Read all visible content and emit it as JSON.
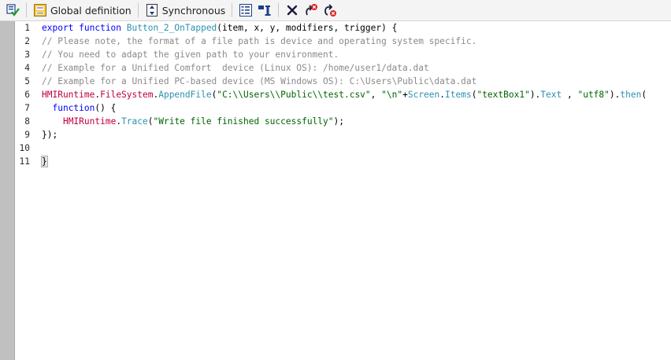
{
  "toolbar": {
    "global_definition_label": "Global definition",
    "synchronous_label": "Synchronous"
  },
  "editor": {
    "line_numbers": [
      "1",
      "2",
      "3",
      "4",
      "5",
      "6",
      "7",
      "8",
      "9",
      "10",
      "11"
    ],
    "lines": [
      {
        "indent": "",
        "tokens": [
          {
            "t": "export function ",
            "c": "kw"
          },
          {
            "t": "Button_2_OnTapped",
            "c": "fn"
          },
          {
            "t": "(item, x, y, modifiers, trigger) {",
            "c": "pl"
          }
        ]
      },
      {
        "indent": "",
        "tokens": [
          {
            "t": "// Please note, the format of a file path is device and operating system specific.",
            "c": "cm"
          }
        ]
      },
      {
        "indent": "",
        "tokens": [
          {
            "t": "// You need to adapt the given path to your environment.",
            "c": "cm"
          }
        ]
      },
      {
        "indent": "",
        "tokens": [
          {
            "t": "// Example for a Unified Comfort  device (Linux OS): /home/user1/data.dat",
            "c": "cm"
          }
        ]
      },
      {
        "indent": "",
        "tokens": [
          {
            "t": "// Example for a Unified PC-based device (MS Windows OS): C:\\Users\\Public\\data.dat",
            "c": "cm"
          }
        ]
      },
      {
        "indent": "",
        "tokens": [
          {
            "t": "HMIRuntime",
            "c": "obj"
          },
          {
            "t": ".",
            "c": "pl"
          },
          {
            "t": "FileSystem",
            "c": "obj"
          },
          {
            "t": ".",
            "c": "pl"
          },
          {
            "t": "AppendFile",
            "c": "fn"
          },
          {
            "t": "(",
            "c": "pl"
          },
          {
            "t": "\"C:\\\\Users\\\\Public\\\\test.csv\"",
            "c": "str"
          },
          {
            "t": ", ",
            "c": "pl"
          },
          {
            "t": "\"\\n\"",
            "c": "str"
          },
          {
            "t": "+",
            "c": "pl"
          },
          {
            "t": "Screen",
            "c": "fn"
          },
          {
            "t": ".",
            "c": "pl"
          },
          {
            "t": "Items",
            "c": "fn"
          },
          {
            "t": "(",
            "c": "pl"
          },
          {
            "t": "\"textBox1\"",
            "c": "str"
          },
          {
            "t": ").",
            "c": "pl"
          },
          {
            "t": "Text",
            "c": "fn"
          },
          {
            "t": " , ",
            "c": "pl"
          },
          {
            "t": "\"utf8\"",
            "c": "str"
          },
          {
            "t": ").",
            "c": "pl"
          },
          {
            "t": "then",
            "c": "fn"
          },
          {
            "t": "(",
            "c": "pl"
          }
        ]
      },
      {
        "indent": "  ",
        "tokens": [
          {
            "t": "function",
            "c": "kw"
          },
          {
            "t": "() {",
            "c": "pl"
          }
        ]
      },
      {
        "indent": "    ",
        "tokens": [
          {
            "t": "HMIRuntime",
            "c": "obj"
          },
          {
            "t": ".",
            "c": "pl"
          },
          {
            "t": "Trace",
            "c": "fn"
          },
          {
            "t": "(",
            "c": "pl"
          },
          {
            "t": "\"Write file finished successfully\"",
            "c": "str"
          },
          {
            "t": ");",
            "c": "pl"
          }
        ]
      },
      {
        "indent": "",
        "tokens": [
          {
            "t": "});",
            "c": "pl"
          }
        ]
      },
      {
        "indent": "",
        "tokens": []
      },
      {
        "indent": "",
        "tokens": [
          {
            "t": "}",
            "c": "pl hl"
          }
        ]
      }
    ]
  },
  "colors": {
    "keyword": "#0000ff",
    "member": "#2b91af",
    "object": "#c0003c",
    "string": "#006400",
    "comment": "#8a8a8a"
  }
}
